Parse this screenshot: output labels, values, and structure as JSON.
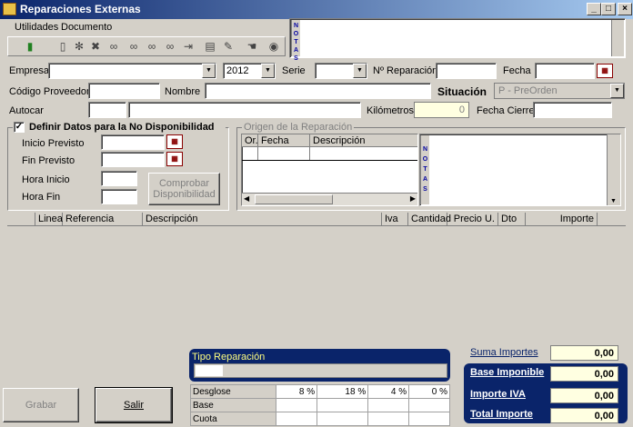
{
  "window": {
    "title": "Reparaciones Externas"
  },
  "menu": {
    "utilidades": "Utilidades",
    "documento": "Documento"
  },
  "notas_label": "N O T A S",
  "form": {
    "empresa_label": "Empresa",
    "empresa_value": "",
    "year_value": "2012",
    "serie_label": "Serie",
    "serie_value": "",
    "nreparacion_label": "Nº Reparación",
    "nreparacion_value": "",
    "fecha_label": "Fecha",
    "fecha_value": "",
    "codigo_label": "Código Proveedor",
    "codigo_value": "",
    "nombre_label": "Nombre",
    "nombre_value": "",
    "situacion_label": "Situación",
    "situacion_value": "P - PreOrden",
    "autocar_label": "Autocar",
    "autocar_value": "",
    "km_label": "Kilómetros",
    "km_value": "0",
    "fecha_cierre_label": "Fecha Cierre",
    "fecha_cierre_value": ""
  },
  "disponibilidad": {
    "checkbox_label": "Definir Datos para la No Disponibilidad",
    "checked": true,
    "inicio_label": "Inicio Previsto",
    "fin_label": "Fin Previsto",
    "hora_inicio_label": "Hora Inicio",
    "hora_fin_label": "Hora Fin",
    "comprobar_label": "Comprobar Disponibilidad"
  },
  "origen": {
    "title": "Origen de la Reparación",
    "columns": [
      "Or.",
      "Fecha",
      "Descripción"
    ]
  },
  "lines_table": {
    "columns": [
      "Linea",
      "Referencia",
      "Descripción",
      "Iva",
      "Cantidad",
      "Precio U.",
      "Dto",
      "Importe"
    ]
  },
  "tipo_reparacion": {
    "title": "Tipo Reparación"
  },
  "desglose": {
    "headers": [
      "Desglose",
      "8 %",
      "18 %",
      "4 %",
      "0 %"
    ],
    "rows": [
      "Base",
      "Cuota"
    ]
  },
  "totals": {
    "suma_label": "Suma Importes",
    "suma_value": "0,00",
    "base_label": "Base Imponible",
    "base_value": "0,00",
    "iva_label": "Importe IVA",
    "iva_value": "0,00",
    "total_label": "Total Importe",
    "total_value": "0,00"
  },
  "buttons": {
    "grabar": "Grabar",
    "salir": "Salir"
  }
}
